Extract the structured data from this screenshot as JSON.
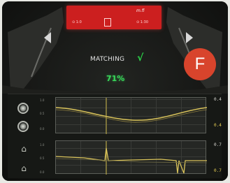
{
  "badge": {
    "label": "F"
  },
  "status": {
    "matching_label": "MATCHING",
    "check_mark": "√",
    "percent": "71%"
  },
  "topbar": {
    "left_text": "⊙ 1:0",
    "right_text": "⊙ 1:30",
    "logo_text": "m.fi"
  },
  "panels": [
    {
      "icon": "gauge-icon",
      "axis_labels": [
        "1.0",
        "0.5",
        "0.0"
      ],
      "values": [
        "0.4",
        "0.4"
      ]
    },
    {
      "icon": "sensor-icon",
      "axis_labels": [
        "1.0",
        "0.5",
        "0.0"
      ],
      "values": [
        "0.7",
        "0.7"
      ]
    }
  ],
  "colors": {
    "accent_red": "#cc1f1f",
    "match_green": "#39d95b",
    "badge_red": "#d8442c",
    "trace_yellow": "#d9c35a"
  }
}
